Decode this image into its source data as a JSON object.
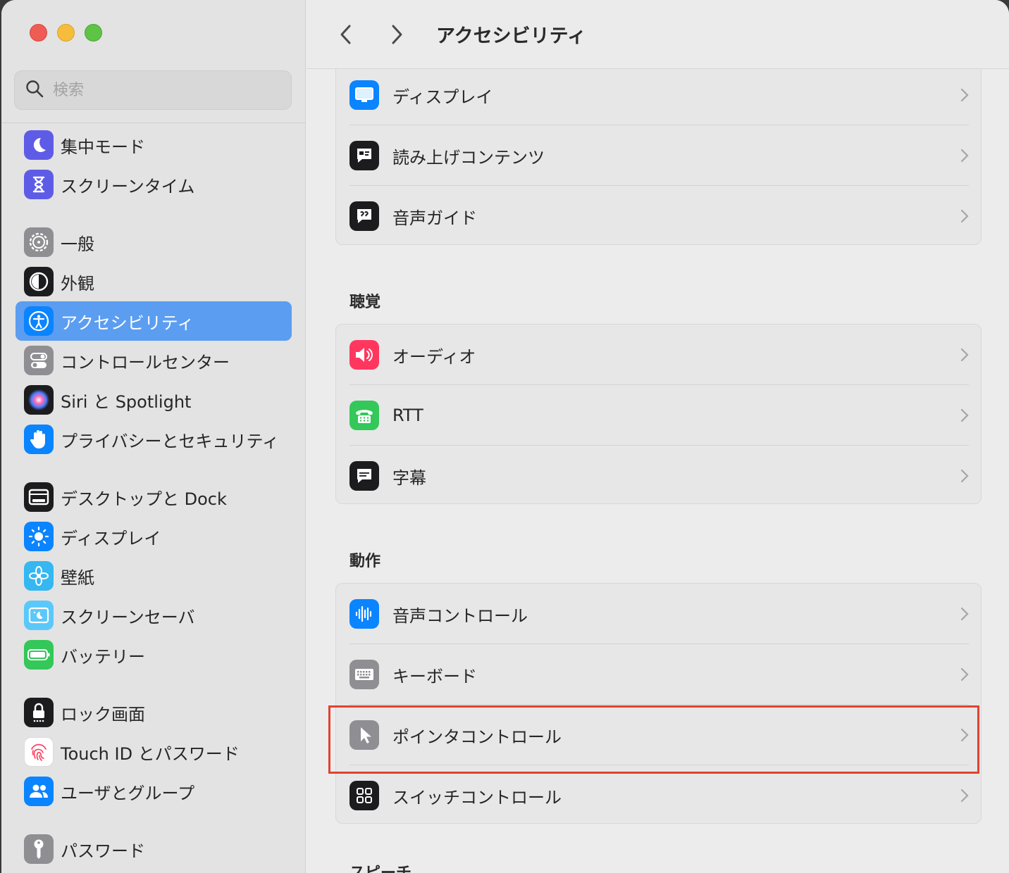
{
  "search": {
    "placeholder": "検索"
  },
  "sidebar": {
    "items": [
      {
        "label": "集中モード",
        "icon": "moon-icon",
        "color": "#5e5ce6"
      },
      {
        "label": "スクリーンタイム",
        "icon": "hourglass-icon",
        "color": "#5e5ce6"
      },
      {
        "label": "一般",
        "icon": "gear-icon",
        "color": "#8e8e93"
      },
      {
        "label": "外観",
        "icon": "appearance-icon",
        "color": "#1c1c1e"
      },
      {
        "label": "アクセシビリティ",
        "icon": "accessibility-icon",
        "color": "#0a84ff",
        "selected": true
      },
      {
        "label": "コントロールセンター",
        "icon": "toggles-icon",
        "color": "#8e8e93"
      },
      {
        "label": "Siri と Spotlight",
        "icon": "siri-icon",
        "color": "#1c1c1e"
      },
      {
        "label": "プライバシーとセキュリティ",
        "icon": "hand-icon",
        "color": "#0a84ff"
      },
      {
        "label": "デスクトップと Dock",
        "icon": "dock-icon",
        "color": "#1c1c1e"
      },
      {
        "label": "ディスプレイ",
        "icon": "sun-icon",
        "color": "#0a84ff"
      },
      {
        "label": "壁紙",
        "icon": "flower-icon",
        "color": "#35b7f2"
      },
      {
        "label": "スクリーンセーバ",
        "icon": "screensaver-icon",
        "color": "#5ac8fa"
      },
      {
        "label": "バッテリー",
        "icon": "battery-icon",
        "color": "#34c759"
      },
      {
        "label": "ロック画面",
        "icon": "lock-icon",
        "color": "#1c1c1e"
      },
      {
        "label": "Touch ID とパスワード",
        "icon": "fingerprint-icon",
        "color": "#ffffff"
      },
      {
        "label": "ユーザとグループ",
        "icon": "users-icon",
        "color": "#0a84ff"
      },
      {
        "label": "パスワード",
        "icon": "key-icon",
        "color": "#8e8e93"
      }
    ]
  },
  "header": {
    "title": "アクセシビリティ"
  },
  "vision": {
    "rows": [
      {
        "label": "ディスプレイ",
        "icon": "monitor-icon",
        "color": "#0a84ff"
      },
      {
        "label": "読み上げコンテンツ",
        "icon": "speech-bubble-icon",
        "color": "#1c1c1e"
      },
      {
        "label": "音声ガイド",
        "icon": "voiceover-icon",
        "color": "#1c1c1e"
      }
    ]
  },
  "hearing": {
    "title": "聴覚",
    "rows": [
      {
        "label": "オーディオ",
        "icon": "speaker-icon",
        "color": "#ff375f"
      },
      {
        "label": "RTT",
        "icon": "tty-icon",
        "color": "#34c759"
      },
      {
        "label": "字幕",
        "icon": "captions-icon",
        "color": "#1c1c1e"
      }
    ]
  },
  "motor": {
    "title": "動作",
    "rows": [
      {
        "label": "音声コントロール",
        "icon": "waveform-icon",
        "color": "#0a84ff"
      },
      {
        "label": "キーボード",
        "icon": "keyboard-icon",
        "color": "#8e8e93"
      },
      {
        "label": "ポインタコントロール",
        "icon": "pointer-icon",
        "color": "#8e8e93"
      },
      {
        "label": "スイッチコントロール",
        "icon": "switch-grid-icon",
        "color": "#1c1c1e"
      }
    ]
  },
  "next_section": {
    "title": "スピーチ"
  }
}
